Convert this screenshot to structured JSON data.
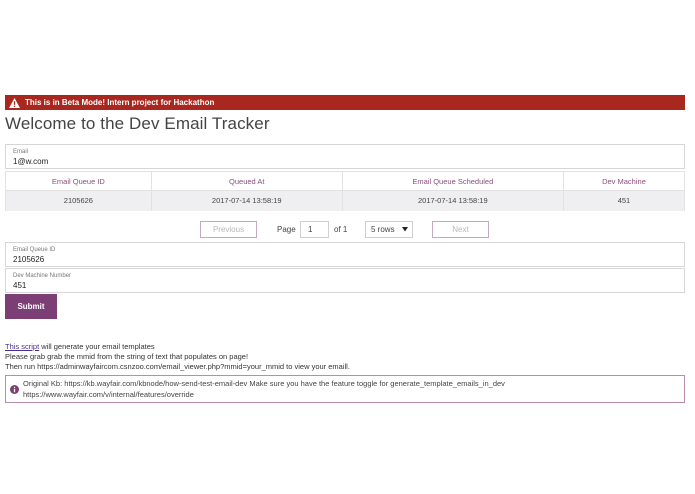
{
  "banner": {
    "text": "This is in Beta Mode! Intern project for Hackathon"
  },
  "page": {
    "title": "Welcome to the Dev Email Tracker"
  },
  "email_field": {
    "label": "Email",
    "value": "1@w.com"
  },
  "table": {
    "columns": [
      "Email Queue ID",
      "Queued At",
      "Email Queue Scheduled",
      "Dev Machine"
    ],
    "rows": [
      [
        "2105626",
        "2017-07-14 13:58:19",
        "2017-07-14 13:58:19",
        "451"
      ]
    ]
  },
  "pagination": {
    "previous": "Previous",
    "page_label": "Page",
    "page_value": "1",
    "of_label": "of 1",
    "rows_option": "5 rows",
    "next": "Next"
  },
  "queue_id_field": {
    "label": "Email Queue ID",
    "value": "2105626"
  },
  "dev_machine_field": {
    "label": "Dev Machine Number",
    "value": "451"
  },
  "submit": {
    "label": "Submit"
  },
  "instructions": {
    "link_text": "This script",
    "line1_rest": " will generate your email templates",
    "line2": "Please grab grab the mmid from the string of text that populates on page!",
    "line3": "Then run https://adminwayfaircom.csnzoo.com/email_viewer.php?mmid=your_mmid to view your emaill."
  },
  "callout": {
    "line1": "Original Kb: https://kb.wayfair.com/kbnode/how-send-test-email-dev Make sure you have the feature toggle for generate_template_emails_in_dev",
    "line2": "https://www.wayfair.com/v/internal/features/override"
  },
  "colors": {
    "banner": "#a8271e",
    "accent": "#7b3f76",
    "header_text": "#8a4f7d"
  }
}
